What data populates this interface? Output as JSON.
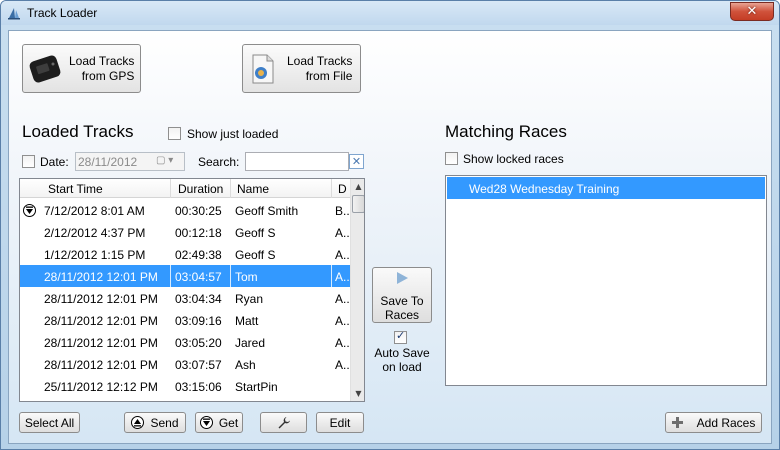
{
  "window": {
    "title": "Track Loader",
    "close_glyph": "✕"
  },
  "toolbar": {
    "load_gps_label": "Load Tracks\nfrom GPS",
    "load_file_label": "Load Tracks\nfrom File"
  },
  "loaded_tracks": {
    "heading": "Loaded Tracks",
    "show_just_loaded_label": "Show just loaded",
    "show_just_loaded_checked": false,
    "date_label": "Date:",
    "date_checked": false,
    "date_value": "28/11/2012",
    "search_label": "Search:",
    "search_value": "",
    "columns": [
      "Start Time",
      "Duration",
      "Name",
      "D"
    ],
    "rows": [
      {
        "start": "7/12/2012 8:01 AM",
        "duration": "00:30:25",
        "name": "Geoff Smith",
        "d": "B..",
        "icon": "download-icon",
        "selected": false
      },
      {
        "start": "2/12/2012 4:37 PM",
        "duration": "00:12:18",
        "name": "Geoff S",
        "d": "A..",
        "selected": false
      },
      {
        "start": "1/12/2012 1:15 PM",
        "duration": "02:49:38",
        "name": "Geoff S",
        "d": "A..",
        "selected": false
      },
      {
        "start": "28/11/2012 12:01 PM",
        "duration": "03:04:57",
        "name": "Tom",
        "d": "A..",
        "selected": true
      },
      {
        "start": "28/11/2012 12:01 PM",
        "duration": "03:04:34",
        "name": "Ryan",
        "d": "A..",
        "selected": false
      },
      {
        "start": "28/11/2012 12:01 PM",
        "duration": "03:09:16",
        "name": "Matt",
        "d": "A..",
        "selected": false
      },
      {
        "start": "28/11/2012 12:01 PM",
        "duration": "03:05:20",
        "name": "Jared",
        "d": "A..",
        "selected": false
      },
      {
        "start": "28/11/2012 12:01 PM",
        "duration": "03:07:57",
        "name": "Ash",
        "d": "A..",
        "selected": false
      },
      {
        "start": "25/11/2012 12:12 PM",
        "duration": "03:15:06",
        "name": "StartPin",
        "d": "",
        "selected": false
      }
    ],
    "buttons": {
      "select_all": "Select All",
      "send": "Send",
      "get": "Get",
      "edit": "Edit"
    }
  },
  "middle": {
    "save_label": "Save To\nRaces",
    "auto_save_label": "Auto Save\non load",
    "auto_save_checked": true
  },
  "matching_races": {
    "heading": "Matching Races",
    "show_locked_label": "Show locked races",
    "show_locked_checked": false,
    "items": [
      "Wed28 Wednesday Training"
    ],
    "add_races_label": "Add Races"
  },
  "colors": {
    "selection": "#3399ff",
    "title_bar": "#c1d8ee",
    "close_button": "#c43d25"
  }
}
